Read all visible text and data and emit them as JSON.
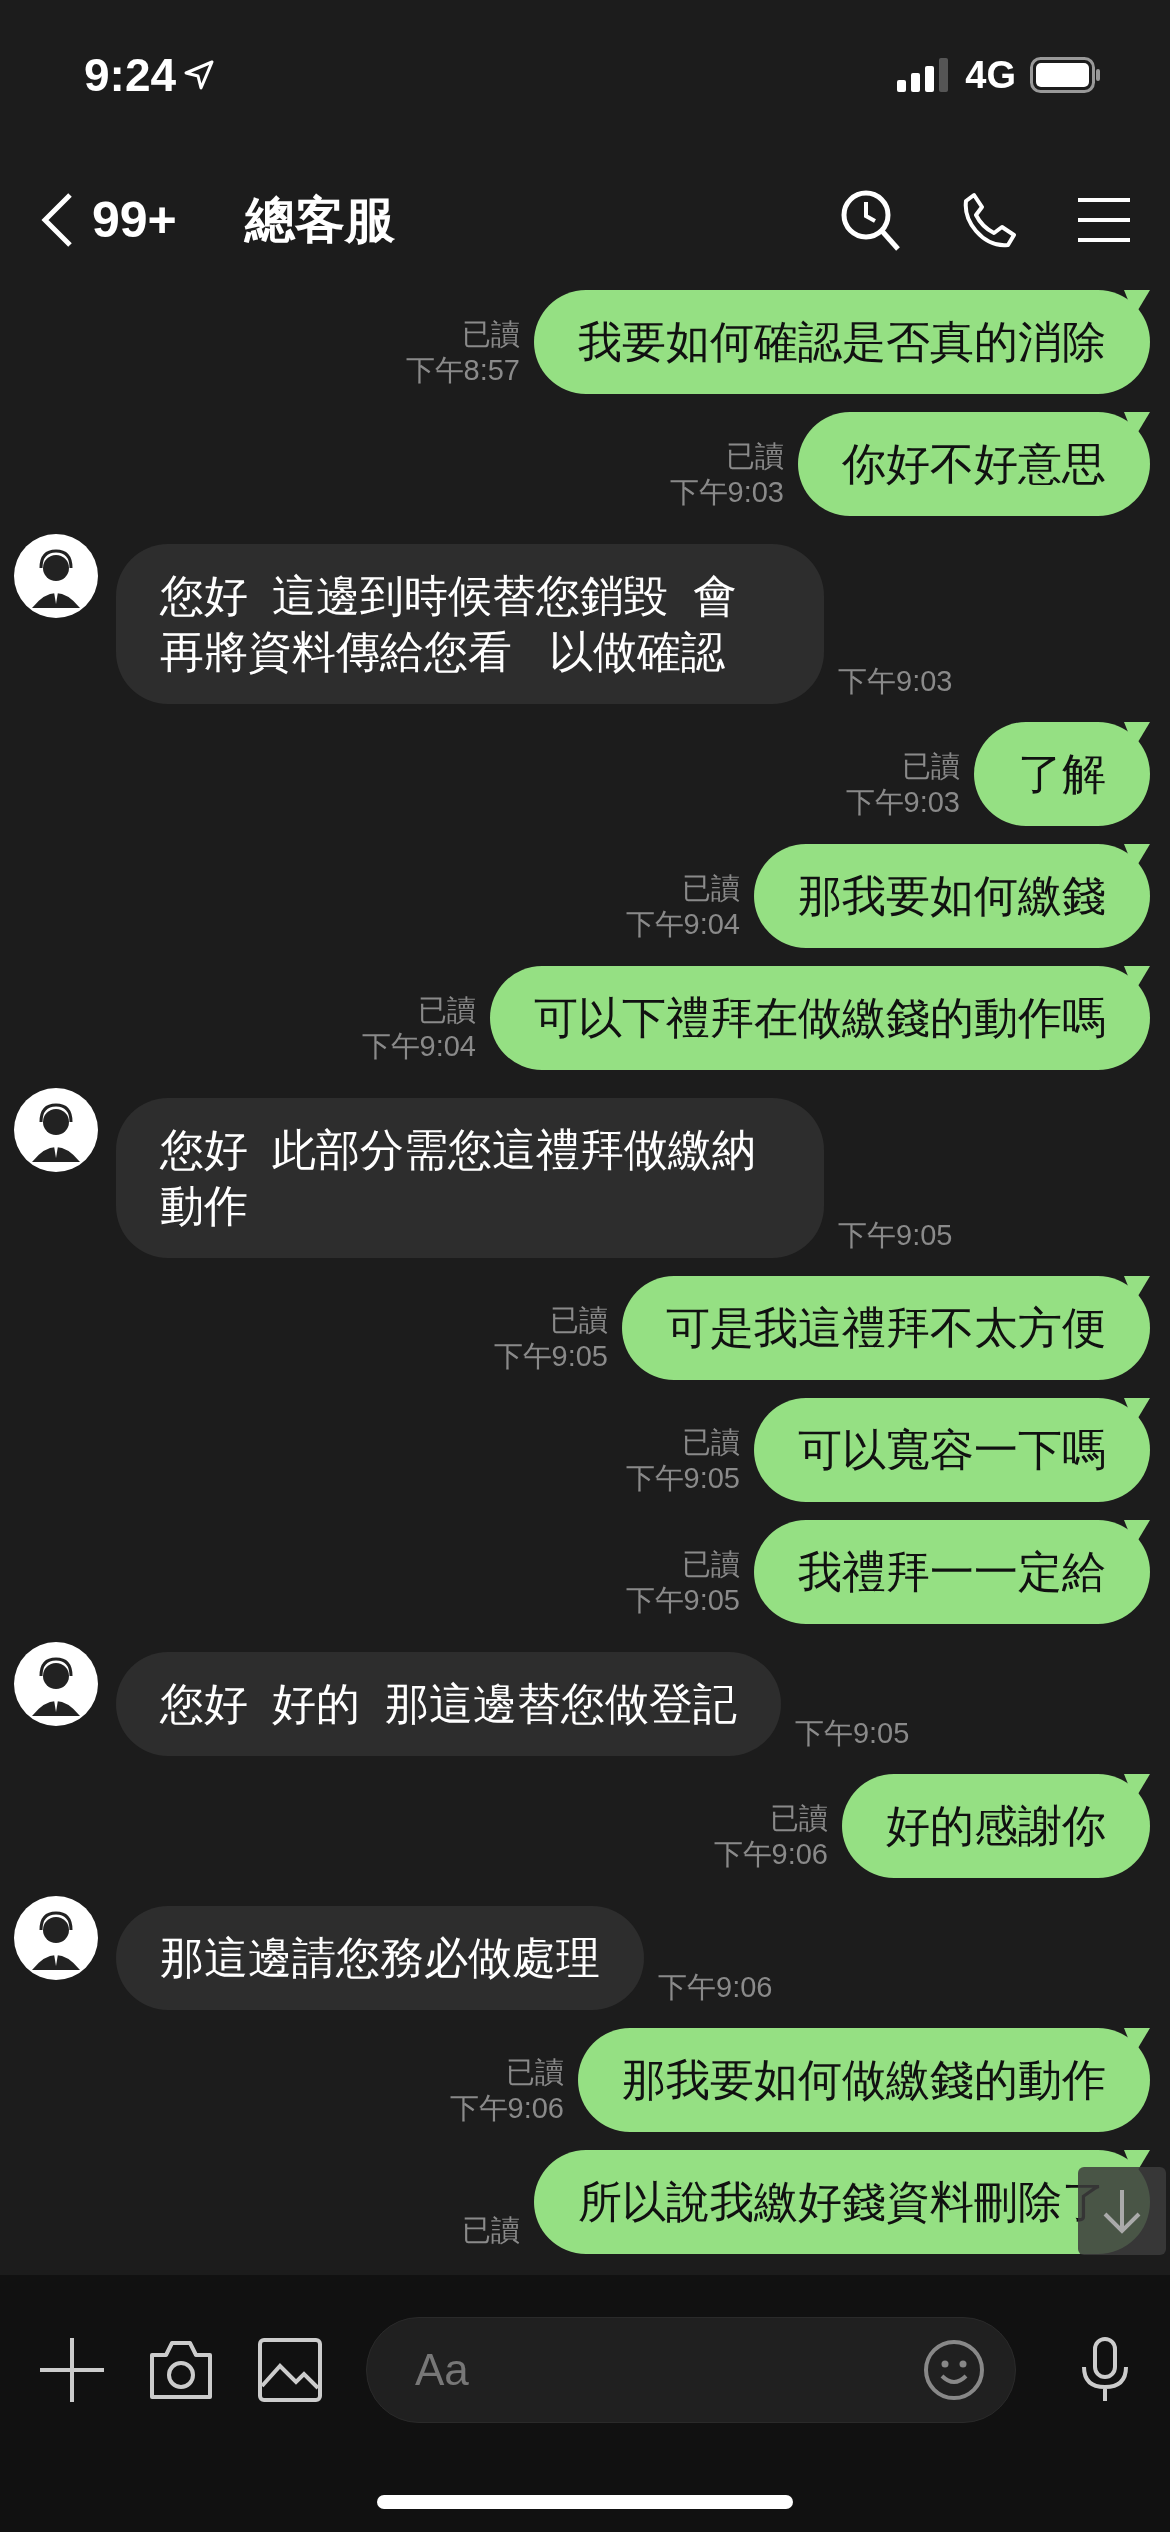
{
  "status_bar": {
    "time": "9:24",
    "network": "4G"
  },
  "header": {
    "back_count": "99+",
    "title": "總客服"
  },
  "messages": [
    {
      "kind": "sent",
      "text": "我要如何確認是否真的消除",
      "read": "已讀",
      "time": "下午8:57"
    },
    {
      "kind": "sent",
      "text": "你好不好意思",
      "read": "已讀",
      "time": "下午9:03"
    },
    {
      "kind": "received",
      "text": "您好  這邊到時候替您銷毀  會再將資料傳給您看   以做確認",
      "time": "下午9:03"
    },
    {
      "kind": "sent",
      "text": "了解",
      "read": "已讀",
      "time": "下午9:03"
    },
    {
      "kind": "sent",
      "text": "那我要如何繳錢",
      "read": "已讀",
      "time": "下午9:04"
    },
    {
      "kind": "sent",
      "text": "可以下禮拜在做繳錢的動作嗎",
      "read": "已讀",
      "time": "下午9:04"
    },
    {
      "kind": "received",
      "text": "您好  此部分需您這禮拜做繳納動作",
      "time": "下午9:05"
    },
    {
      "kind": "sent",
      "text": "可是我這禮拜不太方便",
      "read": "已讀",
      "time": "下午9:05"
    },
    {
      "kind": "sent",
      "text": "可以寬容一下嗎",
      "read": "已讀",
      "time": "下午9:05"
    },
    {
      "kind": "sent",
      "text": "我禮拜一一定給",
      "read": "已讀",
      "time": "下午9:05"
    },
    {
      "kind": "received",
      "text": "您好  好的  那這邊替您做登記",
      "time": "下午9:05"
    },
    {
      "kind": "sent",
      "text": "好的感謝你",
      "read": "已讀",
      "time": "下午9:06"
    },
    {
      "kind": "received",
      "text": "那這邊請您務必做處理",
      "time": "下午9:06"
    },
    {
      "kind": "sent",
      "text": "那我要如何做繳錢的動作",
      "read": "已讀",
      "time": "下午9:06"
    },
    {
      "kind": "sent",
      "text": "所以說我繳好錢資料刪除了",
      "read": "已讀"
    }
  ],
  "composer": {
    "placeholder": "Aa"
  }
}
